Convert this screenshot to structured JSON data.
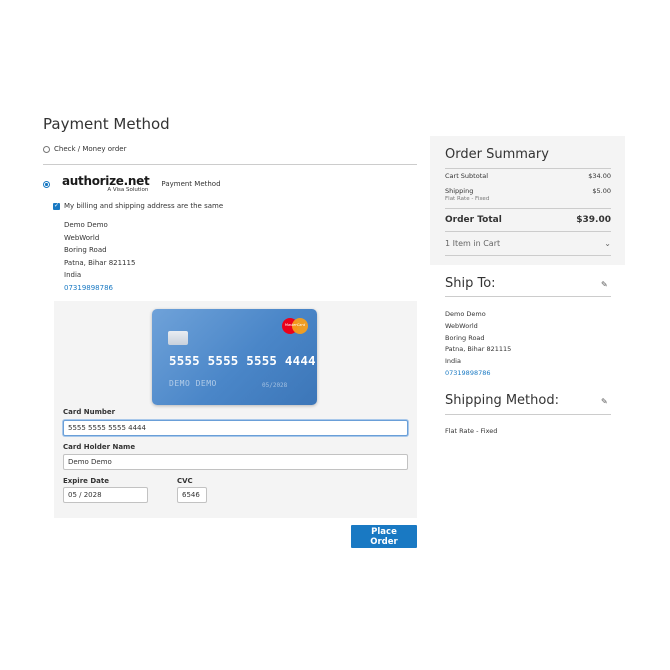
{
  "page": {
    "title": "Payment Method"
  },
  "payment_options": {
    "check_money_order": "Check / Money order",
    "authorize_net": {
      "logo_text": "authorize.net",
      "logo_subtext": "A Visa Solution",
      "label": "Payment Method"
    }
  },
  "billing": {
    "same_as_shipping_label": "My billing and shipping address are the same",
    "lines": [
      "Demo Demo",
      "WebWorld",
      "Boring Road",
      "Patna, Bihar 821115",
      "India"
    ],
    "phone": "07319898786"
  },
  "card_preview": {
    "brand_text": "MasterCard",
    "number": "5555 5555 5555 4444",
    "holder": "DEMO DEMO",
    "expiry": "05/2028"
  },
  "card_form": {
    "number_label": "Card Number",
    "number_value": "5555 5555 5555 4444",
    "holder_label": "Card Holder Name",
    "holder_value": "Demo Demo",
    "expiry_label": "Expire Date",
    "expiry_value": "05 / 2028",
    "cvc_label": "CVC",
    "cvc_value": "6546"
  },
  "actions": {
    "place_order": "Place Order"
  },
  "order_summary": {
    "title": "Order Summary",
    "cart_subtotal_label": "Cart Subtotal",
    "cart_subtotal_value": "$34.00",
    "shipping_label": "Shipping",
    "shipping_method": "Flat Rate - Fixed",
    "shipping_value": "$5.00",
    "order_total_label": "Order Total",
    "order_total_value": "$39.00",
    "items_in_cart": "1 Item in Cart"
  },
  "ship_to": {
    "title": "Ship To:",
    "lines": [
      "Demo Demo",
      "WebWorld",
      "Boring Road",
      "Patna, Bihar 821115",
      "India"
    ],
    "phone": "07319898786"
  },
  "shipping_method": {
    "title": "Shipping Method:",
    "value": "Flat Rate - Fixed"
  },
  "colors": {
    "accent": "#1979c3",
    "panel": "#f4f4f4"
  },
  "icons": {
    "edit": "pencil-icon",
    "expand": "chevron-down-icon",
    "check": "checkmark-icon"
  }
}
